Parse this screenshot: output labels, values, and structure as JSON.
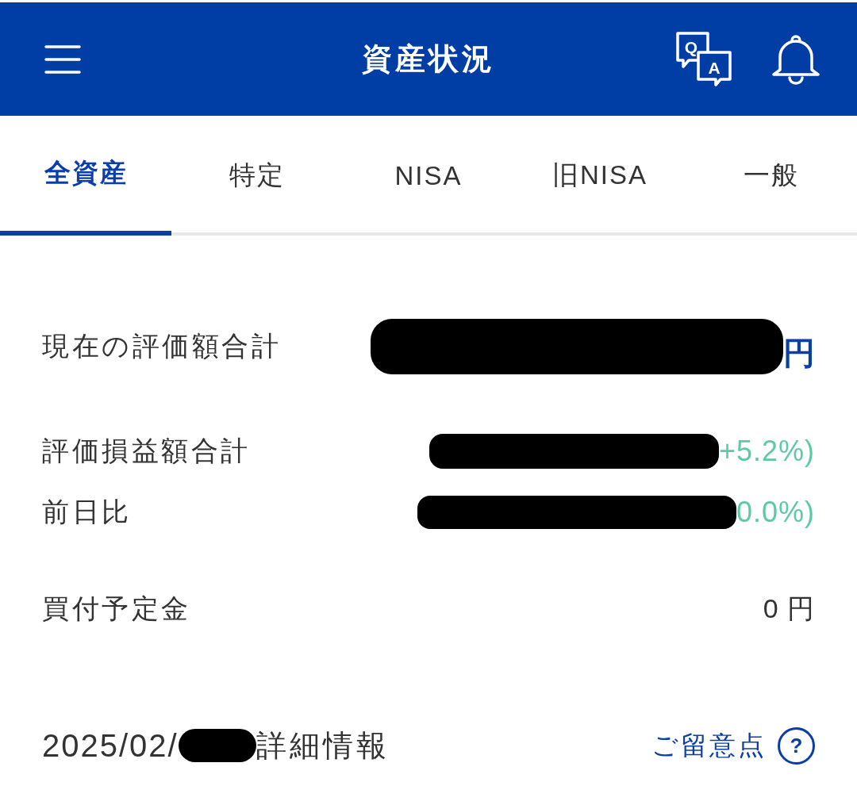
{
  "header": {
    "title": "資産状況",
    "qa_icon": {
      "question": "Q",
      "answer": "A"
    }
  },
  "tabs": [
    {
      "label": "全資産",
      "selected": true
    },
    {
      "label": "特定",
      "selected": false
    },
    {
      "label": "NISA",
      "selected": false
    },
    {
      "label": "旧NISA",
      "selected": false
    },
    {
      "label": "一般",
      "selected": false
    }
  ],
  "summary_sections": [
    {
      "rows": [
        {
          "label": "現在の評価額合計",
          "kind": "total",
          "value_redacted": true,
          "value": "円"
        }
      ]
    },
    {
      "rows": [
        {
          "label": "評価損益額合計",
          "kind": "change",
          "value_redacted": true,
          "value": "+5.2%)"
        },
        {
          "label": "前日比",
          "kind": "change",
          "value_redacted": true,
          "value": "0.0%)"
        }
      ]
    },
    {
      "rows": [
        {
          "label": "買付予定金",
          "kind": "plain",
          "value_redacted": false,
          "value": "0 円"
        }
      ]
    }
  ],
  "details": {
    "date": "2025/02/",
    "date_redacted": true,
    "title": "詳細情報",
    "notes_link": {
      "label": "ご留意点",
      "icon": "?"
    }
  }
}
